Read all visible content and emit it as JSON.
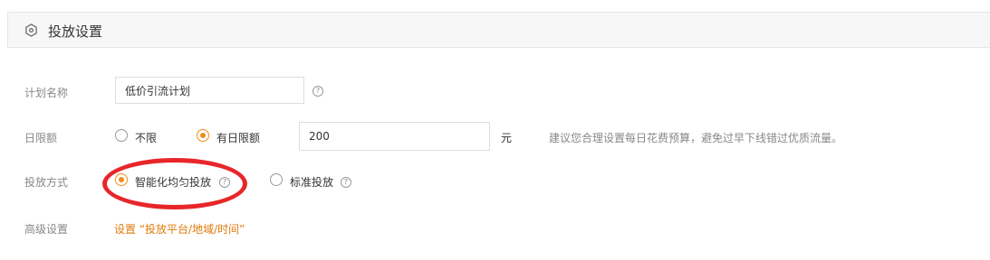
{
  "section": {
    "title": "投放设置",
    "icon": "hexagon-circle-icon"
  },
  "plan_name": {
    "label": "计划名称",
    "value": "低价引流计划",
    "help_icon": "question-circle-icon"
  },
  "daily_budget": {
    "label": "日限额",
    "options": [
      {
        "label": "不限",
        "checked": false
      },
      {
        "label": "有日限额",
        "checked": true
      }
    ],
    "amount": "200",
    "unit": "元",
    "hint": "建议您合理设置每日花费预算，避免过早下线错过优质流量。"
  },
  "delivery_method": {
    "label": "投放方式",
    "options": [
      {
        "label": "智能化均匀投放",
        "checked": true
      },
      {
        "label": "标准投放",
        "checked": false
      }
    ],
    "help_icon": "question-circle-icon"
  },
  "advanced": {
    "label": "高级设置",
    "link": "设置 “投放平台/地域/时间”"
  },
  "colors": {
    "accent": "#f08c1c",
    "link": "#e07b0c",
    "annotation": "#e8262a"
  }
}
